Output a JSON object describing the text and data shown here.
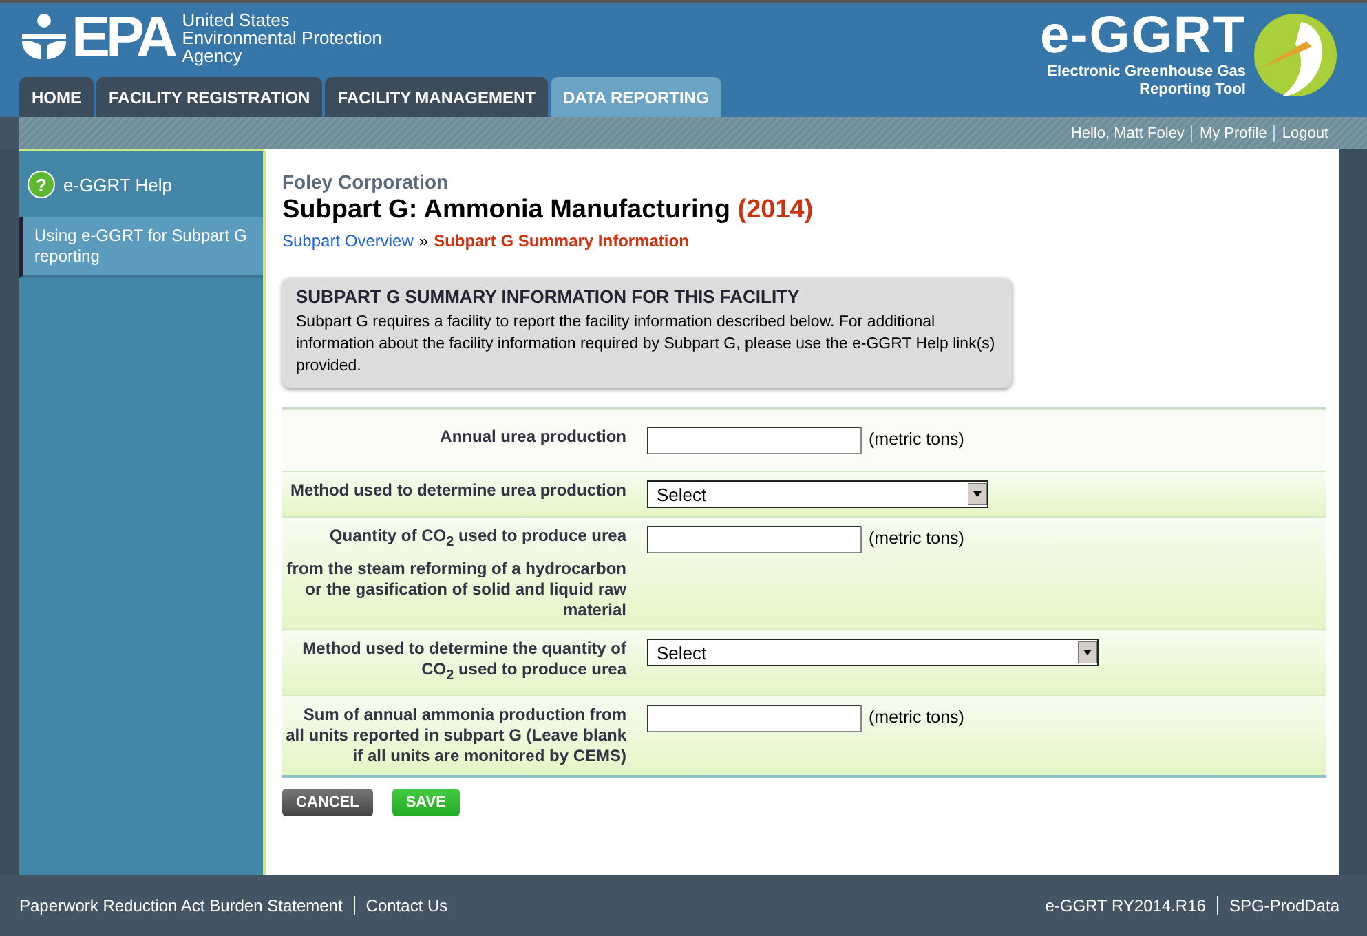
{
  "header": {
    "agency": [
      "United States",
      "Environmental Protection",
      "Agency"
    ],
    "logo_text": "EPA",
    "app_logo": "e-GGRT",
    "app_name": [
      "Electronic Greenhouse Gas",
      "Reporting Tool"
    ]
  },
  "tabs": [
    {
      "label": "HOME",
      "selected": false
    },
    {
      "label": "FACILITY REGISTRATION",
      "selected": false
    },
    {
      "label": "FACILITY MANAGEMENT",
      "selected": false
    },
    {
      "label": "DATA REPORTING",
      "selected": true
    }
  ],
  "user_links": [
    "Hello, Matt Foley",
    "My Profile",
    "Logout"
  ],
  "sidebar": {
    "help_icon": "?",
    "help": "e-GGRT Help",
    "items": [
      {
        "label": "Using e-GGRT for Subpart G reporting",
        "selected": true
      }
    ]
  },
  "page": {
    "company": "Foley Corporation",
    "title": "Subpart G: Ammonia Manufacturing",
    "year": "(2014)",
    "breadcrumb": {
      "link": "Subpart Overview",
      "separator": "»",
      "current": "Subpart G Summary Information"
    }
  },
  "info_box": {
    "heading": "SUBPART G SUMMARY INFORMATION FOR THIS FACILITY",
    "text": "Subpart G requires a facility to report the facility information described below. For additional information about the facility information required by Subpart G, please use the e-GGRT Help link(s) provided."
  },
  "form_rows": [
    {
      "kind": "input",
      "label": "Annual urea production",
      "unit": "(metric tons)"
    },
    {
      "kind": "select",
      "label": "Method used to determine urea production",
      "value": "Select"
    },
    {
      "kind": "input",
      "label": "Quantity of CO$_{2}$ used to produce urea",
      "note": "from the steam reforming of a hydrocarbon or the gasification of solid and liquid raw material",
      "unit": "(metric tons)"
    },
    {
      "kind": "wideselect",
      "label": "Method used to determine the quantity of CO$_{2}$ used to produce urea",
      "value": "Select"
    },
    {
      "kind": "input",
      "label": "Sum of annual ammonia production from all units reported in subpart G (Leave blank if all units are monitored by CEMS)",
      "unit": "(metric tons)"
    }
  ],
  "buttons": [
    {
      "label": "CANCEL",
      "kind": "cancel"
    },
    {
      "label": "SAVE",
      "kind": "save"
    }
  ],
  "footer": {
    "left": [
      "Paperwork Reduction Act Burden Statement",
      "Contact Us"
    ],
    "right": [
      "e-GGRT RY2014.R16",
      "SPG-ProdData"
    ]
  }
}
